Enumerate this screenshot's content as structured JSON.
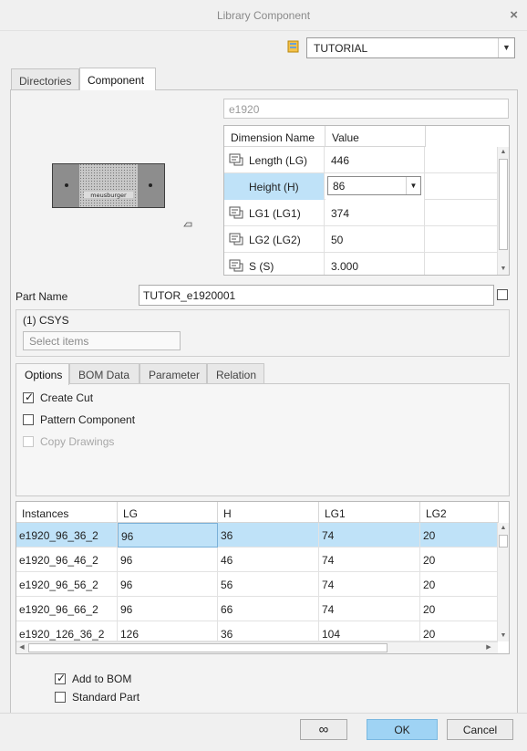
{
  "window": {
    "title": "Library Component",
    "close_icon": "×"
  },
  "library": {
    "selected": "TUTORIAL"
  },
  "tabs": [
    {
      "label": "Directories"
    },
    {
      "label": "Component"
    }
  ],
  "model_field": {
    "value": "e1920"
  },
  "dimension_table": {
    "headers": [
      "Dimension Name",
      "Value"
    ],
    "rows": [
      {
        "name": "Length (LG)",
        "value": "446"
      },
      {
        "name": "Height (H)",
        "value": "86"
      },
      {
        "name": "LG1 (LG1)",
        "value": "374"
      },
      {
        "name": "LG2 (LG2)",
        "value": "50"
      },
      {
        "name": "S (S)",
        "value": "3.000"
      }
    ]
  },
  "part_name": {
    "label": "Part Name",
    "value": "TUTOR_e1920001"
  },
  "csys": {
    "label": "(1) CSYS",
    "placeholder": "Select items"
  },
  "sub_tabs": [
    {
      "label": "Options"
    },
    {
      "label": "BOM Data"
    },
    {
      "label": "Parameter"
    },
    {
      "label": "Relation"
    }
  ],
  "options": {
    "create_cut": "Create Cut",
    "pattern_component": "Pattern Component",
    "copy_drawings": "Copy Drawings"
  },
  "instances_table": {
    "headers": [
      "Instances",
      "LG",
      "H",
      "LG1",
      "LG2"
    ],
    "rows": [
      [
        "e1920_96_36_2",
        "96",
        "36",
        "74",
        "20"
      ],
      [
        "e1920_96_46_2",
        "96",
        "46",
        "74",
        "20"
      ],
      [
        "e1920_96_56_2",
        "96",
        "56",
        "74",
        "20"
      ],
      [
        "e1920_96_66_2",
        "96",
        "66",
        "74",
        "20"
      ],
      [
        "e1920_126_36_2",
        "126",
        "36",
        "104",
        "20"
      ]
    ]
  },
  "bottom_options": {
    "add_to_bom": "Add to BOM",
    "standard_part": "Standard Part"
  },
  "buttons": {
    "preview_icon": "∞",
    "ok": "OK",
    "cancel": "Cancel"
  }
}
